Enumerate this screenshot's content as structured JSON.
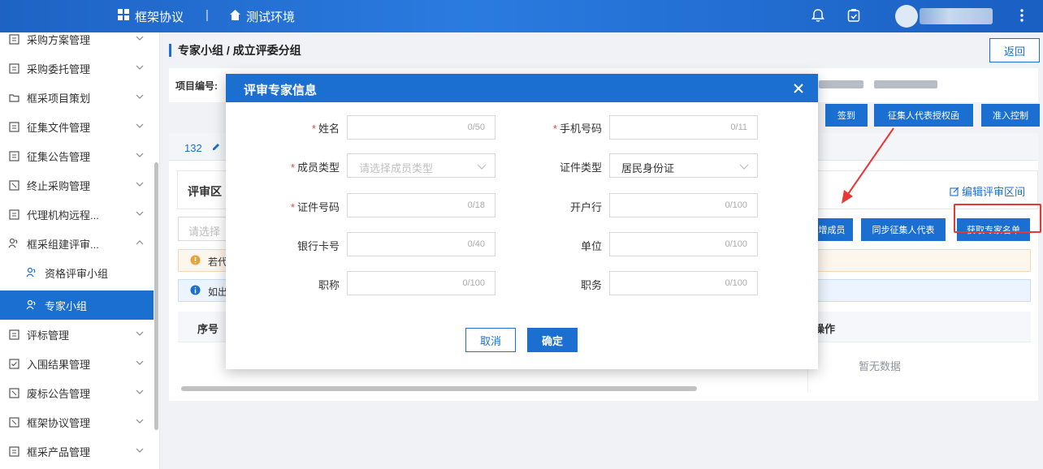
{
  "topbar": {
    "nav_framework": "框架协议",
    "separator": "|",
    "nav_test_env": "测试环境"
  },
  "sidebar": {
    "items": [
      {
        "label": "采购方案管理"
      },
      {
        "label": "采购委托管理"
      },
      {
        "label": "框采项目策划"
      },
      {
        "label": "征集文件管理"
      },
      {
        "label": "征集公告管理"
      },
      {
        "label": "终止采购管理"
      },
      {
        "label": "代理机构远程..."
      },
      {
        "label": "框采组建评审..."
      },
      {
        "label": "资格评审小组"
      },
      {
        "label": "专家小组"
      },
      {
        "label": "评标管理"
      },
      {
        "label": "入围结果管理"
      },
      {
        "label": "废标公告管理"
      },
      {
        "label": "框架协议管理"
      },
      {
        "label": "框采产品管理"
      }
    ]
  },
  "main": {
    "page_title": "专家小组 / 成立评委分组",
    "back_label": "返回",
    "project_no_label": "项目编号:",
    "btn_signin": "签到",
    "btn_collector_auth": "征集人代表授权函",
    "btn_access_control": "准入控制",
    "tab_number": "132",
    "section_title": "评审区",
    "edit_section": "编辑评审区间",
    "select_placeholder": "请选择",
    "btn_add_member": "增成员",
    "btn_sync_rep": "同步征集人代表",
    "btn_fetch_experts": "获取专家名单",
    "warning_text": "若代",
    "info_text": "如出",
    "col_index": "序号",
    "col_action": "操作",
    "empty_text": "暂无数据"
  },
  "modal": {
    "title": "评审专家信息",
    "fields": {
      "name": {
        "label": "姓名",
        "count": "0/50"
      },
      "phone": {
        "label": "手机号码",
        "count": "0/11"
      },
      "member_type": {
        "label": "成员类型",
        "placeholder": "请选择成员类型"
      },
      "id_type": {
        "label": "证件类型",
        "value": "居民身份证"
      },
      "id_number": {
        "label": "证件号码",
        "count": "0/18"
      },
      "bank": {
        "label": "开户行",
        "count": "0/100"
      },
      "bank_card": {
        "label": "银行卡号",
        "count": "0/40"
      },
      "unit": {
        "label": "单位",
        "count": "0/100"
      },
      "title_rank": {
        "label": "职称",
        "count": "0/100"
      },
      "position": {
        "label": "职务",
        "count": "0/100"
      }
    },
    "required_mark": "*",
    "cancel_label": "取消",
    "ok_label": "确定"
  },
  "colors": {
    "primary": "#1a6fd1",
    "required": "#e64545",
    "highlight": "#e53935"
  }
}
